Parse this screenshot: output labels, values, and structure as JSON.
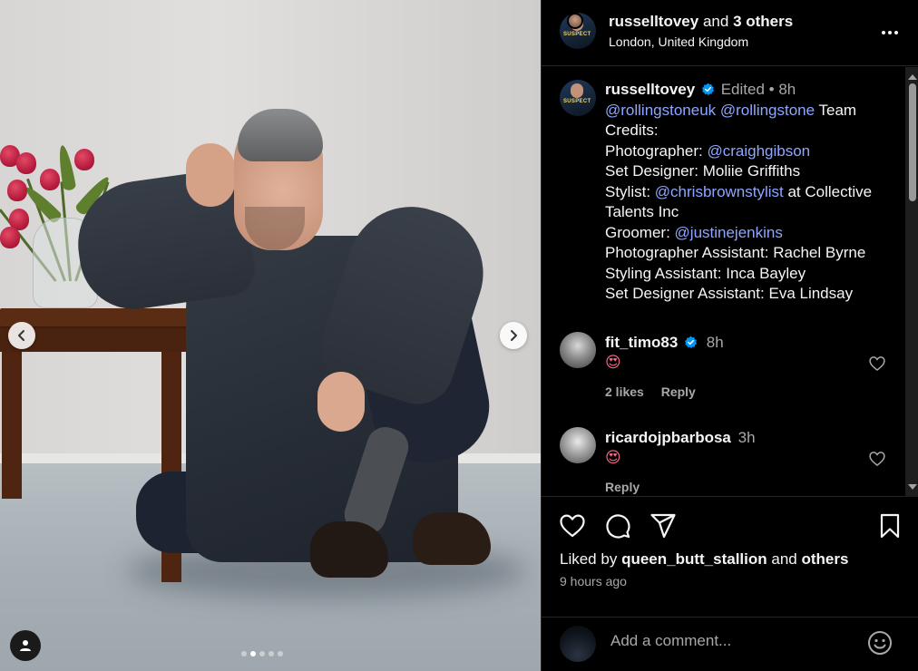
{
  "post": {
    "header": {
      "username": "russelltovey",
      "and_text": "and",
      "others_text": "3 others",
      "location": "London, United Kingdom"
    },
    "caption": {
      "username": "russelltovey",
      "edited": "Edited",
      "separator": "•",
      "time": "8h",
      "lines": [
        {
          "mentions": [
            "@rollingstoneuk",
            "@rollingstone"
          ],
          "text": " Team Credits:"
        },
        {
          "label": "Photographer: ",
          "mention": "@craighgibson"
        },
        {
          "label": "Set Designer: Moliie Griffiths"
        },
        {
          "label": "Stylist: ",
          "mention": "@chrisbrownstylist",
          "suffix": " at Collective Talents Inc"
        },
        {
          "label": "Groomer: ",
          "mention": "@justinejenkins"
        },
        {
          "label": "Photographer Assistant: Rachel Byrne"
        },
        {
          "label": "Styling Assistant: Inca Bayley"
        },
        {
          "label": "Set Designer Assistant: Eva Lindsay"
        }
      ]
    },
    "comments": [
      {
        "username": "fit_timo83",
        "verified": true,
        "time": "8h",
        "text": "😍",
        "likes": "2 likes",
        "reply": "Reply"
      },
      {
        "username": "ricardojpbarbosa",
        "verified": false,
        "time": "3h",
        "text": "😍",
        "reply": "Reply"
      }
    ],
    "liked_by": {
      "prefix": "Liked by",
      "user": "queen_butt_stallion",
      "middle": "and",
      "others": "others"
    },
    "time_ago": "9 hours ago",
    "add_comment": {
      "placeholder": "Add a comment..."
    },
    "carousel": {
      "count": 5,
      "active_index": 1
    }
  },
  "icons": {
    "more": "more-horizontal-icon",
    "like": "heart-icon",
    "comment": "comment-bubble-icon",
    "share": "paper-plane-icon",
    "save": "bookmark-icon",
    "emoji": "smiley-icon",
    "verified": "verified-badge-icon",
    "user_tag": "user-tag-icon",
    "prev": "chevron-left-icon",
    "next": "chevron-right-icon"
  },
  "colors": {
    "background": "#000000",
    "mention": "#8ea6ff",
    "verified": "#0095f6",
    "muted": "#a8a8a8",
    "text": "#f5f5f5"
  }
}
